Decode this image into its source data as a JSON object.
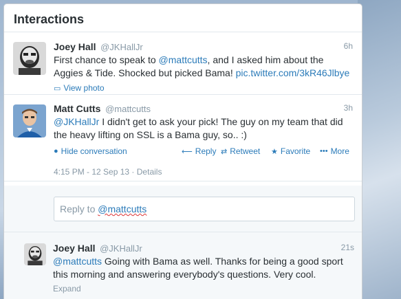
{
  "header": {
    "title": "Interactions"
  },
  "tweets": [
    {
      "name": "Joey Hall",
      "handle": "@JKHallJr",
      "time": "6h",
      "text_before": "First chance to speak to ",
      "mention": "@mattcutts",
      "text_mid": ", and I asked him about the Aggies & Tide. Shocked but picked Bama! ",
      "url": "pic.twitter.com/3kR46Jlbye",
      "action": "View photo"
    },
    {
      "name": "Matt Cutts",
      "handle": "@mattcutts",
      "time": "3h",
      "mention": "@JKHallJr",
      "text_after": " I didn't get to ask your pick! The guy on my team that did the heavy lifting on SSL is a Bama guy, so.. :)",
      "actions": {
        "hide": "Hide conversation",
        "reply": "Reply",
        "retweet": "Retweet",
        "favorite": "Favorite",
        "more": "More"
      },
      "timestamp": "4:15 PM - 12 Sep 13",
      "separator": "·",
      "details": "Details"
    },
    {
      "name": "Joey Hall",
      "handle": "@JKHallJr",
      "time": "21s",
      "mention": "@mattcutts",
      "text_after": " Going with Bama as well. Thanks for being a good sport this morning and answering everybody's questions. Very cool.",
      "action": "Expand"
    }
  ],
  "reply": {
    "prefix": "Reply to ",
    "mention": "@mattcutts"
  }
}
